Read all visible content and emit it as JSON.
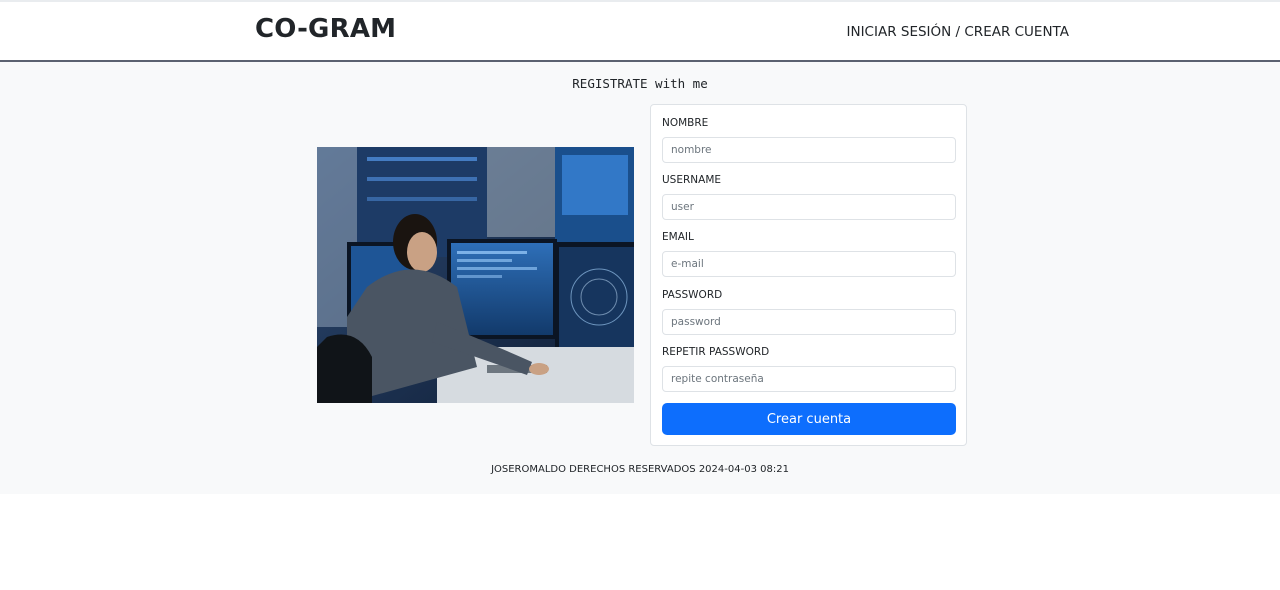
{
  "navbar": {
    "brand": "CO-GRAM",
    "auth_link": "INICIAR SESIÓN / CREAR CUENTA"
  },
  "page": {
    "heading": "REGISTRATE with me"
  },
  "form": {
    "fields": [
      {
        "label": "NOMBRE",
        "placeholder": "nombre",
        "value": ""
      },
      {
        "label": "USERNAME",
        "placeholder": "user",
        "value": ""
      },
      {
        "label": "EMAIL",
        "placeholder": "e-mail",
        "value": ""
      },
      {
        "label": "PASSWORD",
        "placeholder": "password",
        "value": ""
      },
      {
        "label": "REPETIR PASSWORD",
        "placeholder": "repite contraseña",
        "value": ""
      }
    ],
    "submit_label": "Crear cuenta"
  },
  "footer": {
    "text": "JOSEROMALDO DERECHOS RESERVADOS 2024-04-03 08:21"
  },
  "colors": {
    "primary": "#0d6efd",
    "background": "#f8f9fa",
    "navbar_border": "#5b6170"
  }
}
